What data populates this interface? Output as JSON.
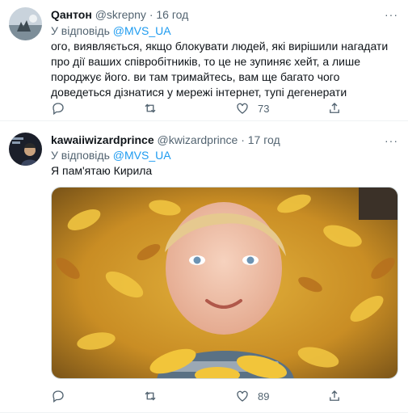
{
  "tweets": [
    {
      "name": "Qантон",
      "handle": "@skrepny",
      "sep": "·",
      "time": "16 год",
      "reply_prefix": "У відповідь",
      "reply_to": "@MVS_UA",
      "text": "ого, виявляється, якщо блокувати людей, які вирішили нагадати про дії ваших співробітників, то це не зупиняє хейт, а лише породжує його. ви там тримайтесь, вам ще багато чого доведеться дізнатися у мережі інтернет, тупі дегенерати",
      "likes": "73",
      "more": "···"
    },
    {
      "name": "kawaiiwizardprince",
      "handle": "@kwizardprince",
      "sep": "·",
      "time": "17 год",
      "reply_prefix": "У відповідь",
      "reply_to": "@MVS_UA",
      "text": "Я пам'ятаю Кирила",
      "likes": "89",
      "more": "···"
    }
  ],
  "colors": {
    "link": "#1d9bf0",
    "muted": "#536471",
    "text": "#0f1419"
  },
  "icons": [
    "reply-icon",
    "retweet-icon",
    "like-icon",
    "share-icon",
    "more-icon"
  ]
}
